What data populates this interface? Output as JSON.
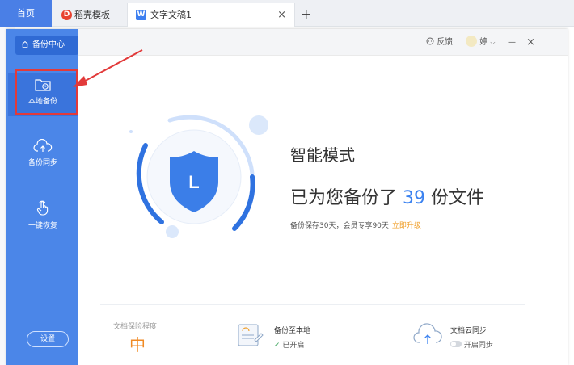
{
  "tabs": {
    "home": "首页",
    "daoke": "稻壳模板",
    "doc": "文字文稿1",
    "doc_close": "×",
    "new": "+"
  },
  "sidebar": {
    "title": "备份中心",
    "items": [
      {
        "label": "本地备份",
        "icon": "folder-clock-icon"
      },
      {
        "label": "备份同步",
        "icon": "cloud-upload-icon"
      },
      {
        "label": "一键恢复",
        "icon": "hand-pointer-icon"
      }
    ],
    "settings": "设置"
  },
  "header": {
    "feedback": "反馈",
    "user": "婷",
    "minimize": "—",
    "close": "×"
  },
  "main": {
    "mode": "智能模式",
    "backup_prefix": "已为您备份了",
    "backup_count": "39",
    "backup_suffix": "份文件",
    "note": "备份保存30天，会员专享90天",
    "upgrade": "立即升级",
    "shield_letter": "L"
  },
  "bottom": {
    "level_label": "文档保险程度",
    "level_value": "中",
    "local_title": "备份至本地",
    "local_status": "已开启",
    "cloud_title": "文档云同步",
    "cloud_status": "开启同步"
  },
  "colors": {
    "sidebar": "#4b86e8",
    "accent": "#3b82f0",
    "orange": "#f08a24",
    "annotation": "#e23a3a"
  }
}
